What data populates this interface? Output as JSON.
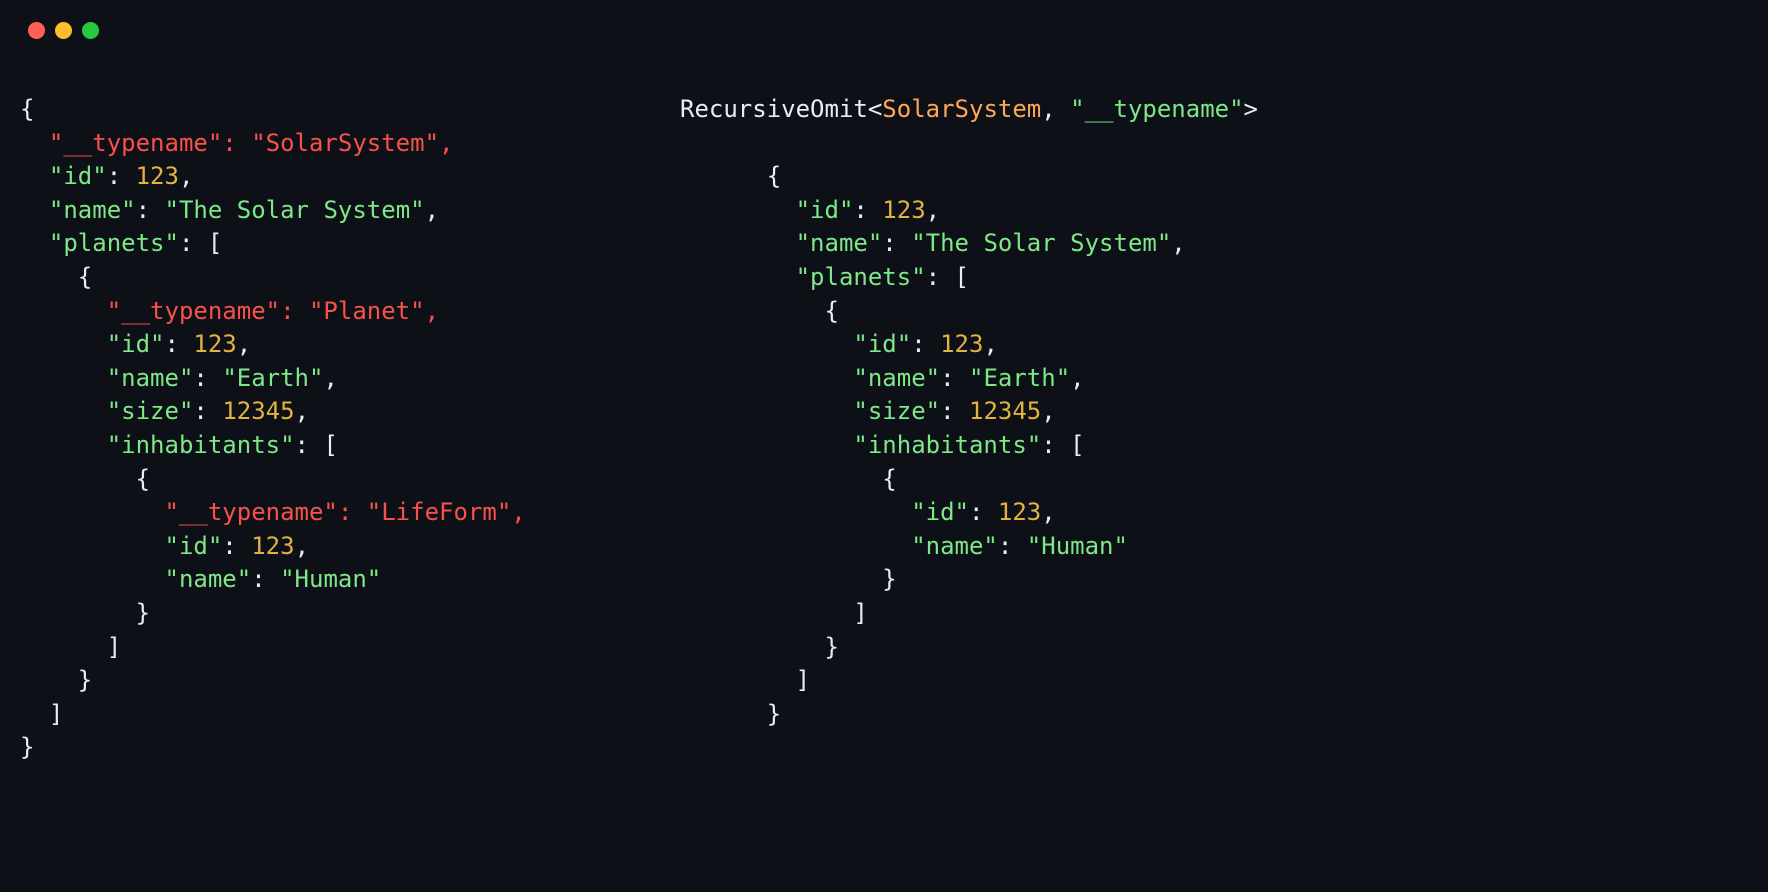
{
  "traffic_lights": [
    "red",
    "yellow",
    "green"
  ],
  "left_lines": [
    {
      "segs": [
        {
          "t": "{",
          "c": "c-punct"
        }
      ]
    },
    {
      "segs": [
        {
          "t": "  \"__typename\": \"SolarSystem\",",
          "c": "c-removed"
        }
      ]
    },
    {
      "segs": [
        {
          "t": "  ",
          "c": "c-punct"
        },
        {
          "t": "\"id\"",
          "c": "c-key"
        },
        {
          "t": ": ",
          "c": "c-punct"
        },
        {
          "t": "123",
          "c": "c-num"
        },
        {
          "t": ",",
          "c": "c-punct"
        }
      ]
    },
    {
      "segs": [
        {
          "t": "  ",
          "c": "c-punct"
        },
        {
          "t": "\"name\"",
          "c": "c-key"
        },
        {
          "t": ": ",
          "c": "c-punct"
        },
        {
          "t": "\"The Solar System\"",
          "c": "c-str"
        },
        {
          "t": ",",
          "c": "c-punct"
        }
      ]
    },
    {
      "segs": [
        {
          "t": "  ",
          "c": "c-punct"
        },
        {
          "t": "\"planets\"",
          "c": "c-key"
        },
        {
          "t": ": [",
          "c": "c-punct"
        }
      ]
    },
    {
      "segs": [
        {
          "t": "    {",
          "c": "c-punct"
        }
      ]
    },
    {
      "segs": [
        {
          "t": "      \"__typename\": \"Planet\",",
          "c": "c-removed"
        }
      ]
    },
    {
      "segs": [
        {
          "t": "      ",
          "c": "c-punct"
        },
        {
          "t": "\"id\"",
          "c": "c-key"
        },
        {
          "t": ": ",
          "c": "c-punct"
        },
        {
          "t": "123",
          "c": "c-num"
        },
        {
          "t": ",",
          "c": "c-punct"
        }
      ]
    },
    {
      "segs": [
        {
          "t": "      ",
          "c": "c-punct"
        },
        {
          "t": "\"name\"",
          "c": "c-key"
        },
        {
          "t": ": ",
          "c": "c-punct"
        },
        {
          "t": "\"Earth\"",
          "c": "c-str"
        },
        {
          "t": ",",
          "c": "c-punct"
        }
      ]
    },
    {
      "segs": [
        {
          "t": "      ",
          "c": "c-punct"
        },
        {
          "t": "\"size\"",
          "c": "c-key"
        },
        {
          "t": ": ",
          "c": "c-punct"
        },
        {
          "t": "12345",
          "c": "c-num"
        },
        {
          "t": ",",
          "c": "c-punct"
        }
      ]
    },
    {
      "segs": [
        {
          "t": "      ",
          "c": "c-punct"
        },
        {
          "t": "\"inhabitants\"",
          "c": "c-key"
        },
        {
          "t": ": [",
          "c": "c-punct"
        }
      ]
    },
    {
      "segs": [
        {
          "t": "        {",
          "c": "c-punct"
        }
      ]
    },
    {
      "segs": [
        {
          "t": "          \"__typename\": \"LifeForm\",",
          "c": "c-removed"
        }
      ]
    },
    {
      "segs": [
        {
          "t": "          ",
          "c": "c-punct"
        },
        {
          "t": "\"id\"",
          "c": "c-key"
        },
        {
          "t": ": ",
          "c": "c-punct"
        },
        {
          "t": "123",
          "c": "c-num"
        },
        {
          "t": ",",
          "c": "c-punct"
        }
      ]
    },
    {
      "segs": [
        {
          "t": "          ",
          "c": "c-punct"
        },
        {
          "t": "\"name\"",
          "c": "c-key"
        },
        {
          "t": ": ",
          "c": "c-punct"
        },
        {
          "t": "\"Human\"",
          "c": "c-str"
        }
      ]
    },
    {
      "segs": [
        {
          "t": "        }",
          "c": "c-punct"
        }
      ]
    },
    {
      "segs": [
        {
          "t": "      ]",
          "c": "c-punct"
        }
      ]
    },
    {
      "segs": [
        {
          "t": "    }",
          "c": "c-punct"
        }
      ]
    },
    {
      "segs": [
        {
          "t": "  ]",
          "c": "c-punct"
        }
      ]
    },
    {
      "segs": [
        {
          "t": "}",
          "c": "c-punct"
        }
      ]
    }
  ],
  "right_header": {
    "fn": "RecursiveOmit",
    "lt": "<",
    "type": "SolarSystem",
    "comma": ", ",
    "arg": "\"__typename\"",
    "gt": ">"
  },
  "right_lines": [
    {
      "segs": [
        {
          "t": "      {",
          "c": "c-punct"
        }
      ]
    },
    {
      "segs": [
        {
          "t": "        ",
          "c": "c-punct"
        },
        {
          "t": "\"id\"",
          "c": "c-key"
        },
        {
          "t": ": ",
          "c": "c-punct"
        },
        {
          "t": "123",
          "c": "c-num"
        },
        {
          "t": ",",
          "c": "c-punct"
        }
      ]
    },
    {
      "segs": [
        {
          "t": "        ",
          "c": "c-punct"
        },
        {
          "t": "\"name\"",
          "c": "c-key"
        },
        {
          "t": ": ",
          "c": "c-punct"
        },
        {
          "t": "\"The Solar System\"",
          "c": "c-str"
        },
        {
          "t": ",",
          "c": "c-punct"
        }
      ]
    },
    {
      "segs": [
        {
          "t": "        ",
          "c": "c-punct"
        },
        {
          "t": "\"planets\"",
          "c": "c-key"
        },
        {
          "t": ": [",
          "c": "c-punct"
        }
      ]
    },
    {
      "segs": [
        {
          "t": "          {",
          "c": "c-punct"
        }
      ]
    },
    {
      "segs": [
        {
          "t": "            ",
          "c": "c-punct"
        },
        {
          "t": "\"id\"",
          "c": "c-key"
        },
        {
          "t": ": ",
          "c": "c-punct"
        },
        {
          "t": "123",
          "c": "c-num"
        },
        {
          "t": ",",
          "c": "c-punct"
        }
      ]
    },
    {
      "segs": [
        {
          "t": "            ",
          "c": "c-punct"
        },
        {
          "t": "\"name\"",
          "c": "c-key"
        },
        {
          "t": ": ",
          "c": "c-punct"
        },
        {
          "t": "\"Earth\"",
          "c": "c-str"
        },
        {
          "t": ",",
          "c": "c-punct"
        }
      ]
    },
    {
      "segs": [
        {
          "t": "            ",
          "c": "c-punct"
        },
        {
          "t": "\"size\"",
          "c": "c-key"
        },
        {
          "t": ": ",
          "c": "c-punct"
        },
        {
          "t": "12345",
          "c": "c-num"
        },
        {
          "t": ",",
          "c": "c-punct"
        }
      ]
    },
    {
      "segs": [
        {
          "t": "            ",
          "c": "c-punct"
        },
        {
          "t": "\"inhabitants\"",
          "c": "c-key"
        },
        {
          "t": ": [",
          "c": "c-punct"
        }
      ]
    },
    {
      "segs": [
        {
          "t": "              {",
          "c": "c-punct"
        }
      ]
    },
    {
      "segs": [
        {
          "t": "                ",
          "c": "c-punct"
        },
        {
          "t": "\"id\"",
          "c": "c-key"
        },
        {
          "t": ": ",
          "c": "c-punct"
        },
        {
          "t": "123",
          "c": "c-num"
        },
        {
          "t": ",",
          "c": "c-punct"
        }
      ]
    },
    {
      "segs": [
        {
          "t": "                ",
          "c": "c-punct"
        },
        {
          "t": "\"name\"",
          "c": "c-key"
        },
        {
          "t": ": ",
          "c": "c-punct"
        },
        {
          "t": "\"Human\"",
          "c": "c-str"
        }
      ]
    },
    {
      "segs": [
        {
          "t": "              }",
          "c": "c-punct"
        }
      ]
    },
    {
      "segs": [
        {
          "t": "            ]",
          "c": "c-punct"
        }
      ]
    },
    {
      "segs": [
        {
          "t": "          }",
          "c": "c-punct"
        }
      ]
    },
    {
      "segs": [
        {
          "t": "        ]",
          "c": "c-punct"
        }
      ]
    },
    {
      "segs": [
        {
          "t": "      }",
          "c": "c-punct"
        }
      ]
    }
  ]
}
